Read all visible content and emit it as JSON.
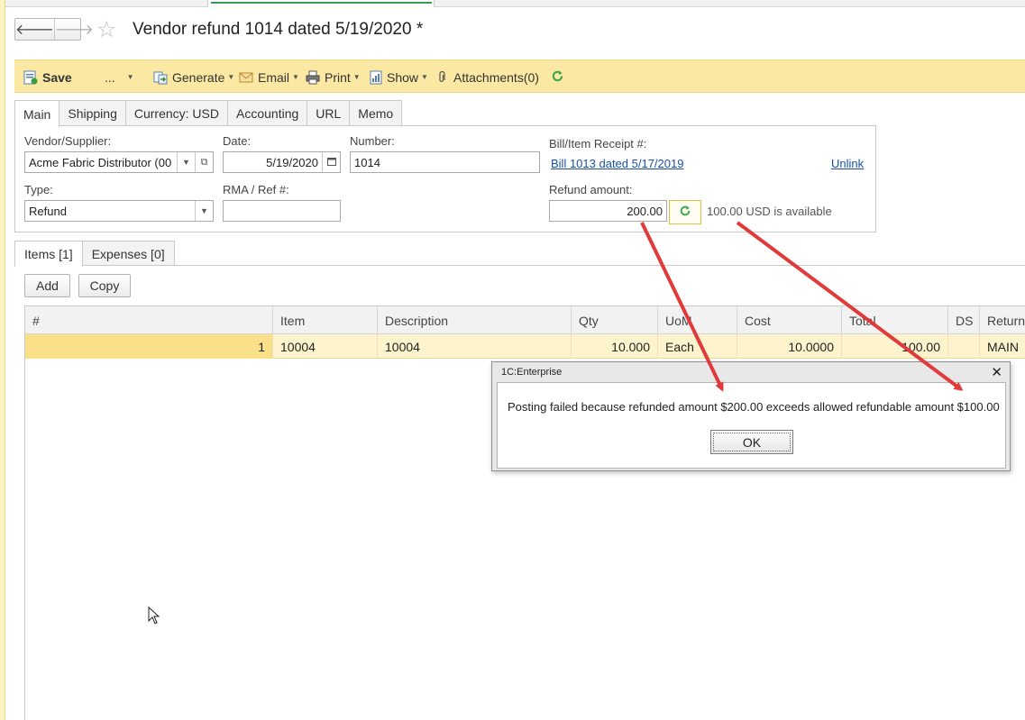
{
  "title": "Vendor refund 1014 dated 5/19/2020 *",
  "toolbar": {
    "save": "Save",
    "more": "...",
    "generate": "Generate",
    "email": "Email",
    "print": "Print",
    "show": "Show",
    "attachments": "Attachments(0)"
  },
  "tabs": [
    "Main",
    "Shipping",
    "Currency: USD",
    "Accounting",
    "URL",
    "Memo"
  ],
  "form": {
    "vendor_label": "Vendor/Supplier:",
    "vendor_value": "Acme Fabric Distributor (00",
    "date_label": "Date:",
    "date_value": "5/19/2020",
    "number_label": "Number:",
    "number_value": "1014",
    "bill_label": "Bill/Item Receipt #:",
    "bill_link": "Bill 1013 dated 5/17/2019",
    "unlink": "Unlink",
    "type_label": "Type:",
    "type_value": "Refund",
    "rma_label": "RMA / Ref #:",
    "rma_value": "",
    "refund_label": "Refund amount:",
    "refund_value": "200.00",
    "available": "100.00 USD is available"
  },
  "subtabs": [
    "Items [1]",
    "Expenses [0]"
  ],
  "buttons": {
    "add": "Add",
    "copy": "Copy"
  },
  "table": {
    "columns": [
      "#",
      "Item",
      "Description",
      "Qty",
      "UoM",
      "Cost",
      "Total",
      "DS",
      "Return t"
    ],
    "rows": [
      [
        "1",
        "10004",
        "10004",
        "10.000",
        "Each",
        "10.0000",
        "100.00",
        "",
        "MAIN"
      ]
    ]
  },
  "dialog": {
    "title": "1C:Enterprise",
    "message": "Posting failed because refunded amount $200.00 exceeds allowed refundable amount $100.00",
    "ok": "OK"
  },
  "colors": {
    "toolbar_bg": "#fbe8a3",
    "selected_row": "#fdf3cc",
    "arrow": "#e03a3a",
    "link": "#1a4fa8"
  }
}
